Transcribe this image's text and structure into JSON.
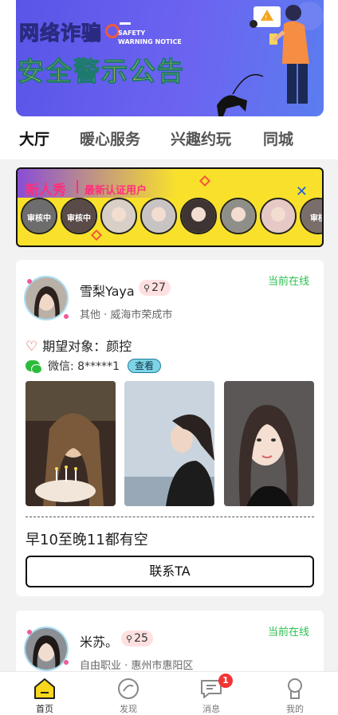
{
  "banner": {
    "title_line1": "网络诈骗",
    "warning_en_line1": "SAFETY",
    "warning_en_line2": "WARNING NOTICE",
    "title_line2": "安全警示公告"
  },
  "tabs": [
    {
      "label": "大厅",
      "active": true
    },
    {
      "label": "暖心服务",
      "active": false
    },
    {
      "label": "兴趣约玩",
      "active": false
    },
    {
      "label": "同城",
      "active": false
    }
  ],
  "new_show": {
    "title": "新人秀",
    "subtitle": "最新认证用户",
    "avatars": [
      {
        "label": "审核中",
        "color": "#6d6d6d"
      },
      {
        "label": "审核中",
        "color": "#5a4a48"
      },
      {
        "label": "",
        "color": "#d8cfc8"
      },
      {
        "label": "",
        "color": "#c9c4c4"
      },
      {
        "label": "",
        "color": "#3e3433"
      },
      {
        "label": "",
        "color": "#8f8f8a"
      },
      {
        "label": "",
        "color": "#e6c9c6"
      },
      {
        "label": "审核",
        "color": "#7a6e6a"
      }
    ]
  },
  "profiles": [
    {
      "name": "雪梨Yaya",
      "likes": "27",
      "status": "当前在线",
      "meta": "其他 · 威海市荣成市",
      "expect": "期望对象：颜控",
      "wechat": "微信: 8*****1",
      "view_label": "查看",
      "availability": "早10至晚11都有空",
      "contact_label": "联系TA",
      "photo_colors": [
        "#3a2c24",
        "#b6c4d2",
        "#4a4848"
      ]
    },
    {
      "name": "米苏。",
      "likes": "25",
      "status": "当前在线",
      "meta": "自由职业 · 惠州市惠阳区"
    }
  ],
  "bottom_nav": [
    {
      "label": "首页",
      "icon": "home-icon",
      "active": true
    },
    {
      "label": "发现",
      "icon": "discover-icon",
      "active": false
    },
    {
      "label": "消息",
      "icon": "message-icon",
      "active": false,
      "badge": "1"
    },
    {
      "label": "我的",
      "icon": "profile-icon",
      "active": false
    }
  ],
  "colors": {
    "accent_yellow": "#f9d71c",
    "online_green": "#2bbf4e",
    "pink": "#ff2f7a"
  }
}
